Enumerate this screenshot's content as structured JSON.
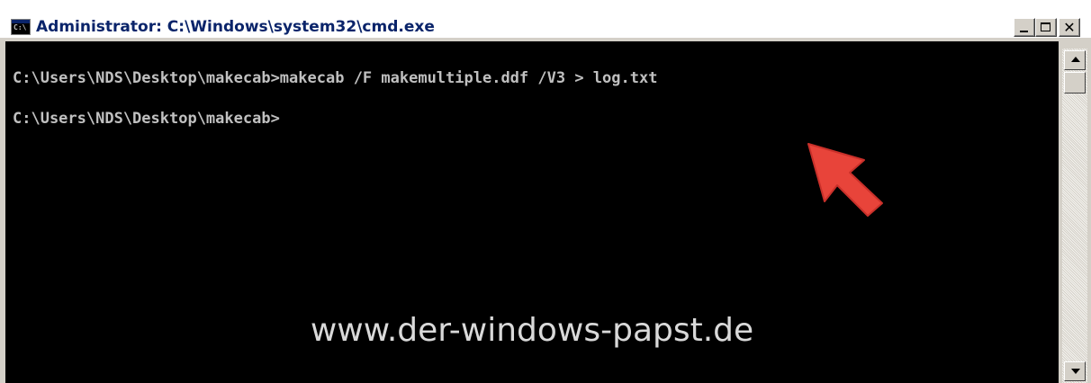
{
  "window": {
    "title": "Administrator: C:\\Windows\\system32\\cmd.exe",
    "app_icon_text": "C:\\",
    "icon": "cmd-console-icon",
    "controls": {
      "minimize_icon": "minimize-icon",
      "maximize_icon": "maximize-icon",
      "close_icon": "close-icon",
      "close_glyph": "✕"
    }
  },
  "console": {
    "lines": [
      "C:\\Users\\NDS\\Desktop\\makecab>makecab /F makemultiple.ddf /V3 > log.txt",
      "C:\\Users\\NDS\\Desktop\\makecab>"
    ],
    "background": "#000000",
    "text_color": "#c0c0c0"
  },
  "overlay": {
    "watermark": "www.der-windows-papst.de",
    "arrow_icon": "pointer-arrow-icon",
    "arrow_color": "#e8443a"
  },
  "scrollbar": {
    "up_icon": "scroll-up-arrow-icon",
    "down_icon": "scroll-down-arrow-icon"
  }
}
